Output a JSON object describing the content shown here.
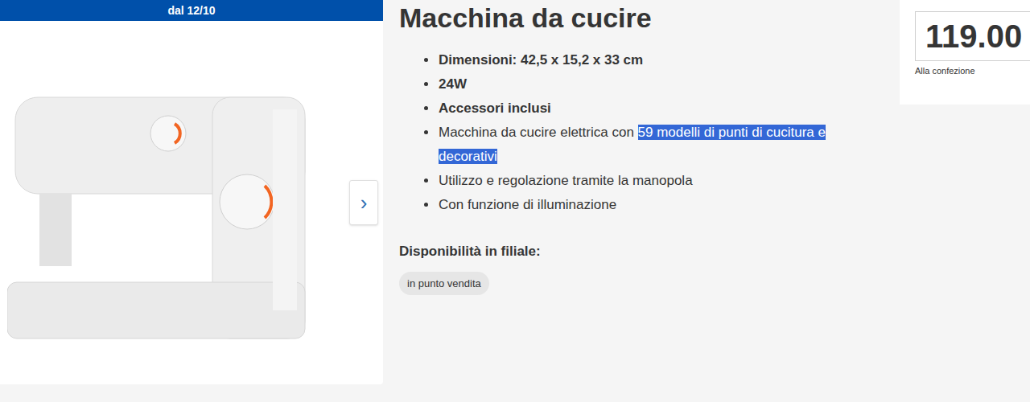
{
  "banner": {
    "label": "dal 12/10"
  },
  "gallery": {
    "next": "›"
  },
  "product": {
    "title": "Macchina da cucire",
    "features": [
      {
        "bold": true,
        "parts": [
          {
            "text": "Dimensioni: 42,5 x 15,2 x 33 cm",
            "selected": false
          }
        ]
      },
      {
        "bold": true,
        "parts": [
          {
            "text": "24W",
            "selected": false
          }
        ]
      },
      {
        "bold": true,
        "parts": [
          {
            "text": "Accessori inclusi",
            "selected": false
          }
        ]
      },
      {
        "bold": false,
        "parts": [
          {
            "text": "Macchina da cucire elettrica con ",
            "selected": false
          },
          {
            "text": "59 modelli di punti di cucitura e decorativi",
            "selected": true
          }
        ]
      },
      {
        "bold": false,
        "parts": [
          {
            "text": "Utilizzo e regolazione tramite la manopola",
            "selected": false
          }
        ]
      },
      {
        "bold": false,
        "parts": [
          {
            "text": "Con funzione di illuminazione",
            "selected": false
          }
        ]
      }
    ]
  },
  "availability": {
    "label": "Disponibilità in filiale:",
    "badge": "in punto vendita"
  },
  "price": {
    "value": "119.00",
    "unit": "Alla confezione"
  }
}
